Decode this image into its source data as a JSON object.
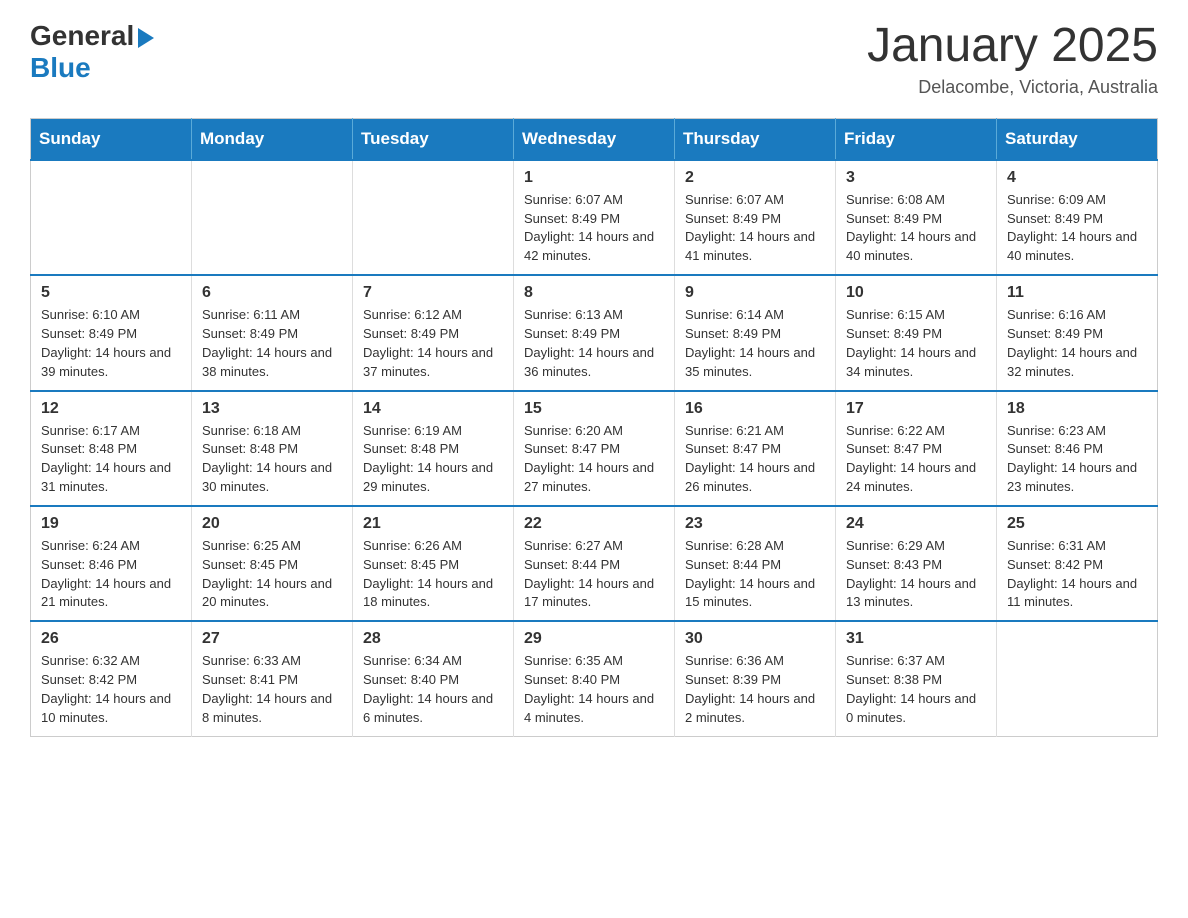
{
  "logo": {
    "general": "General",
    "blue": "Blue"
  },
  "title": "January 2025",
  "location": "Delacombe, Victoria, Australia",
  "days_of_week": [
    "Sunday",
    "Monday",
    "Tuesday",
    "Wednesday",
    "Thursday",
    "Friday",
    "Saturday"
  ],
  "weeks": [
    [
      {
        "day": "",
        "info": ""
      },
      {
        "day": "",
        "info": ""
      },
      {
        "day": "",
        "info": ""
      },
      {
        "day": "1",
        "info": "Sunrise: 6:07 AM\nSunset: 8:49 PM\nDaylight: 14 hours and 42 minutes."
      },
      {
        "day": "2",
        "info": "Sunrise: 6:07 AM\nSunset: 8:49 PM\nDaylight: 14 hours and 41 minutes."
      },
      {
        "day": "3",
        "info": "Sunrise: 6:08 AM\nSunset: 8:49 PM\nDaylight: 14 hours and 40 minutes."
      },
      {
        "day": "4",
        "info": "Sunrise: 6:09 AM\nSunset: 8:49 PM\nDaylight: 14 hours and 40 minutes."
      }
    ],
    [
      {
        "day": "5",
        "info": "Sunrise: 6:10 AM\nSunset: 8:49 PM\nDaylight: 14 hours and 39 minutes."
      },
      {
        "day": "6",
        "info": "Sunrise: 6:11 AM\nSunset: 8:49 PM\nDaylight: 14 hours and 38 minutes."
      },
      {
        "day": "7",
        "info": "Sunrise: 6:12 AM\nSunset: 8:49 PM\nDaylight: 14 hours and 37 minutes."
      },
      {
        "day": "8",
        "info": "Sunrise: 6:13 AM\nSunset: 8:49 PM\nDaylight: 14 hours and 36 minutes."
      },
      {
        "day": "9",
        "info": "Sunrise: 6:14 AM\nSunset: 8:49 PM\nDaylight: 14 hours and 35 minutes."
      },
      {
        "day": "10",
        "info": "Sunrise: 6:15 AM\nSunset: 8:49 PM\nDaylight: 14 hours and 34 minutes."
      },
      {
        "day": "11",
        "info": "Sunrise: 6:16 AM\nSunset: 8:49 PM\nDaylight: 14 hours and 32 minutes."
      }
    ],
    [
      {
        "day": "12",
        "info": "Sunrise: 6:17 AM\nSunset: 8:48 PM\nDaylight: 14 hours and 31 minutes."
      },
      {
        "day": "13",
        "info": "Sunrise: 6:18 AM\nSunset: 8:48 PM\nDaylight: 14 hours and 30 minutes."
      },
      {
        "day": "14",
        "info": "Sunrise: 6:19 AM\nSunset: 8:48 PM\nDaylight: 14 hours and 29 minutes."
      },
      {
        "day": "15",
        "info": "Sunrise: 6:20 AM\nSunset: 8:47 PM\nDaylight: 14 hours and 27 minutes."
      },
      {
        "day": "16",
        "info": "Sunrise: 6:21 AM\nSunset: 8:47 PM\nDaylight: 14 hours and 26 minutes."
      },
      {
        "day": "17",
        "info": "Sunrise: 6:22 AM\nSunset: 8:47 PM\nDaylight: 14 hours and 24 minutes."
      },
      {
        "day": "18",
        "info": "Sunrise: 6:23 AM\nSunset: 8:46 PM\nDaylight: 14 hours and 23 minutes."
      }
    ],
    [
      {
        "day": "19",
        "info": "Sunrise: 6:24 AM\nSunset: 8:46 PM\nDaylight: 14 hours and 21 minutes."
      },
      {
        "day": "20",
        "info": "Sunrise: 6:25 AM\nSunset: 8:45 PM\nDaylight: 14 hours and 20 minutes."
      },
      {
        "day": "21",
        "info": "Sunrise: 6:26 AM\nSunset: 8:45 PM\nDaylight: 14 hours and 18 minutes."
      },
      {
        "day": "22",
        "info": "Sunrise: 6:27 AM\nSunset: 8:44 PM\nDaylight: 14 hours and 17 minutes."
      },
      {
        "day": "23",
        "info": "Sunrise: 6:28 AM\nSunset: 8:44 PM\nDaylight: 14 hours and 15 minutes."
      },
      {
        "day": "24",
        "info": "Sunrise: 6:29 AM\nSunset: 8:43 PM\nDaylight: 14 hours and 13 minutes."
      },
      {
        "day": "25",
        "info": "Sunrise: 6:31 AM\nSunset: 8:42 PM\nDaylight: 14 hours and 11 minutes."
      }
    ],
    [
      {
        "day": "26",
        "info": "Sunrise: 6:32 AM\nSunset: 8:42 PM\nDaylight: 14 hours and 10 minutes."
      },
      {
        "day": "27",
        "info": "Sunrise: 6:33 AM\nSunset: 8:41 PM\nDaylight: 14 hours and 8 minutes."
      },
      {
        "day": "28",
        "info": "Sunrise: 6:34 AM\nSunset: 8:40 PM\nDaylight: 14 hours and 6 minutes."
      },
      {
        "day": "29",
        "info": "Sunrise: 6:35 AM\nSunset: 8:40 PM\nDaylight: 14 hours and 4 minutes."
      },
      {
        "day": "30",
        "info": "Sunrise: 6:36 AM\nSunset: 8:39 PM\nDaylight: 14 hours and 2 minutes."
      },
      {
        "day": "31",
        "info": "Sunrise: 6:37 AM\nSunset: 8:38 PM\nDaylight: 14 hours and 0 minutes."
      },
      {
        "day": "",
        "info": ""
      }
    ]
  ]
}
